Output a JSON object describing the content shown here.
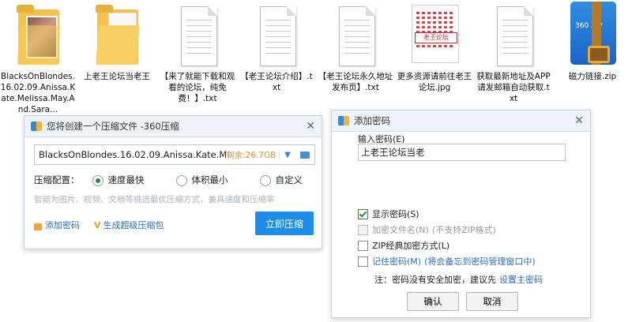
{
  "desktop": {
    "icons": [
      {
        "label": "BlacksOnBlondes.16.02.09.Anissa.Kate.Melissa.May.And.Sara...",
        "type": "folder-photo"
      },
      {
        "label": "上老王论坛当老王",
        "type": "folder"
      },
      {
        "label": "【来了就能下载和观看的论坛，纯免费！】.txt",
        "type": "txt"
      },
      {
        "label": "【老王论坛介绍】.txt",
        "type": "txt"
      },
      {
        "label": "【老王论坛永久地址发布页】.txt",
        "type": "txt"
      },
      {
        "label": "更多资源请前往老王论坛.jpg",
        "type": "jpg",
        "image_text": "老王论坛"
      },
      {
        "label": "获取最新地址及APP请发邮箱自动获取.txt",
        "type": "txt"
      },
      {
        "label": "磁力链接.zip",
        "type": "zip",
        "image_text": "360 ZIP"
      }
    ]
  },
  "compress_dialog": {
    "title": "您将创建一个压缩文件 -360压缩",
    "path": "BlacksOnBlondes.16.02.09.Anissa.Kate.Me",
    "remaining": "剩余:26.7GB",
    "config_label": "压缩配置：",
    "options": [
      "速度最快",
      "体积最小",
      "自定义"
    ],
    "selected_option": "速度最快",
    "hint": "智能为图片、视频、文档等挑选最优压缩方式，兼具速度和压缩率",
    "add_password_link": "添加密码",
    "super_package_link": "生成超级压缩包",
    "compress_button": "立即压缩",
    "close_icon": "close-icon"
  },
  "password_dialog": {
    "title": "添加密码",
    "input_label": "输入密码(E)",
    "password_value": "上老王论坛当老",
    "show_password": {
      "label": "显示密码(S)",
      "checked": true
    },
    "encrypt_names": {
      "label": "加密文件名(N)",
      "note": "(不支持ZIP格式)",
      "checked": false,
      "disabled": true
    },
    "zip_classic": {
      "label": "ZIP经典加密方式(L)",
      "checked": false
    },
    "remember_password": {
      "label": "记住密码(M)",
      "note": "(将会备忘到密码管理窗口中)",
      "checked": false
    },
    "warning_prefix": "注：密码没有安全加密，建议先",
    "warning_link": "设置主密码",
    "ok_button": "确认",
    "cancel_button": "取消"
  },
  "colors": {
    "accent": "#1e8de8",
    "link": "#2c6fc3",
    "remaining": "#f08a2c",
    "check": "#2d8a3d"
  }
}
